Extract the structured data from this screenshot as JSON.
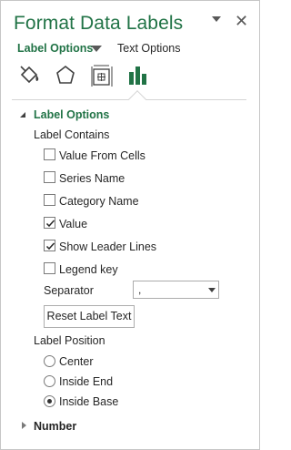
{
  "pane": {
    "title": "Format Data Labels"
  },
  "tabs": {
    "label_options": "Label Options",
    "text_options": "Text Options"
  },
  "icons": [
    "fill-line-icon",
    "effects-icon",
    "size-properties-icon",
    "label-options-icon"
  ],
  "section_label_options": {
    "title": "Label Options",
    "label_contains": {
      "heading": "Label Contains",
      "options": [
        {
          "label": "Value From Cells",
          "checked": false
        },
        {
          "label": "Series Name",
          "checked": false
        },
        {
          "label": "Category Name",
          "checked": false
        },
        {
          "label": "Value",
          "checked": true
        },
        {
          "label": "Show Leader Lines",
          "checked": true
        },
        {
          "label": "Legend key",
          "checked": false
        }
      ]
    },
    "separator": {
      "label": "Separator",
      "value": ","
    },
    "reset_button": "Reset Label Text",
    "label_position": {
      "heading": "Label Position",
      "options": [
        {
          "label": "Center",
          "selected": false
        },
        {
          "label": "Inside End",
          "selected": false
        },
        {
          "label": "Inside Base",
          "selected": true
        }
      ]
    }
  },
  "section_number": {
    "title": "Number"
  },
  "colors": {
    "accent": "#217346",
    "text": "#262626",
    "border": "#7a7a7a"
  }
}
